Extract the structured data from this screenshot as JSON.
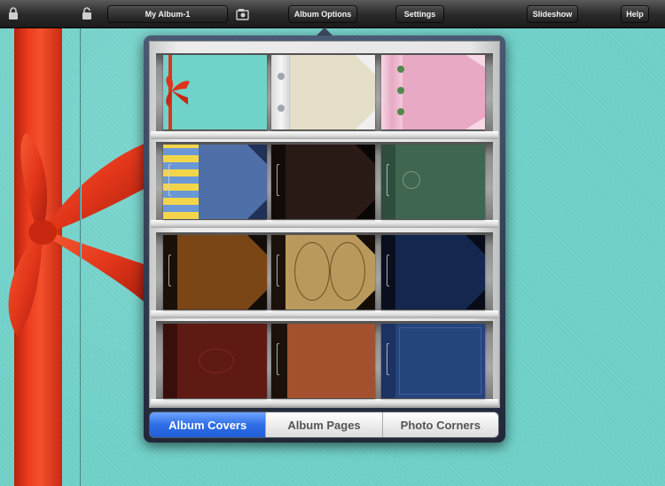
{
  "toolbar": {
    "album_name": "My Album-1",
    "album_options": "Album Options",
    "settings": "Settings",
    "slideshow": "Slideshow",
    "help": "Help"
  },
  "segments": [
    {
      "label": "Album Covers",
      "active": true
    },
    {
      "label": "Album Pages",
      "active": false
    },
    {
      "label": "Photo Corners",
      "active": false
    }
  ],
  "covers": [
    {
      "name": "turquoise with red ribbon",
      "color": "#6fd3c9"
    },
    {
      "name": "cream with white binding",
      "color": "#e5dfc8"
    },
    {
      "name": "pink with green buttons",
      "color": "#e8a9c4"
    },
    {
      "name": "blue with yellow plaid",
      "color": "#4f6fa8"
    },
    {
      "name": "dark brown leather",
      "color": "#2a1a16"
    },
    {
      "name": "green tapestry",
      "color": "#3e6650"
    },
    {
      "name": "reptile brown",
      "color": "#7a4616"
    },
    {
      "name": "world map",
      "color": "#b99a5c"
    },
    {
      "name": "navy blue",
      "color": "#14284f"
    },
    {
      "name": "mahogany wood",
      "color": "#5f1a14"
    },
    {
      "name": "burl wood",
      "color": "#a2502e"
    },
    {
      "name": "royal blue",
      "color": "#26447c"
    }
  ]
}
